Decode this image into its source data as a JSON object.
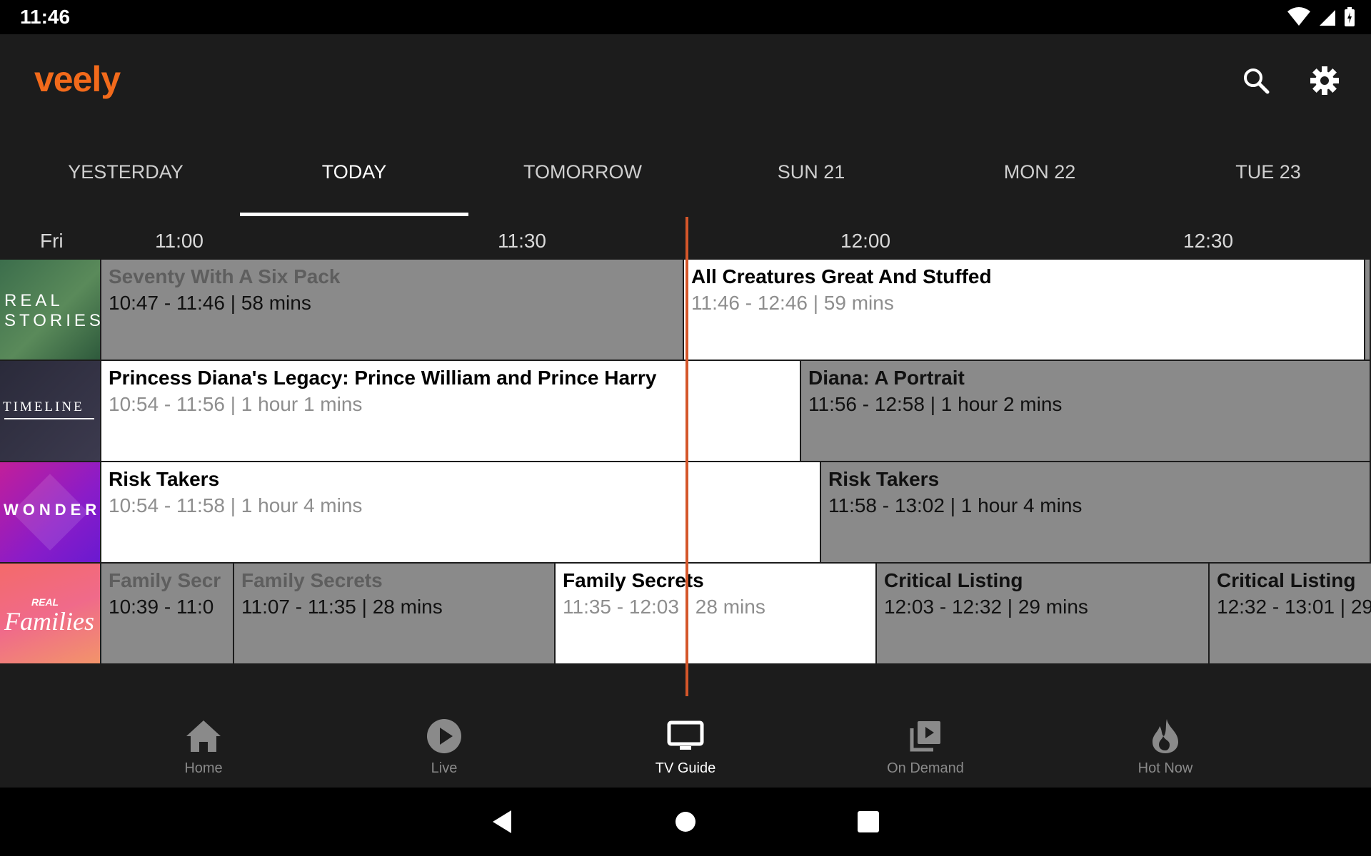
{
  "status_bar": {
    "time": "11:46"
  },
  "app": {
    "logo_text": "veely"
  },
  "date_tabs": [
    "YESTERDAY",
    "TODAY",
    "TOMORROW",
    "SUN 21",
    "MON 22",
    "TUE 23"
  ],
  "active_tab": "TODAY",
  "time_header": {
    "day": "Fri",
    "times": [
      "11:00",
      "11:30",
      "12:00",
      "12:30"
    ]
  },
  "channels": [
    {
      "name": "REAL STORIES",
      "logo_lines": [
        "REAL",
        "STORIES"
      ],
      "programs": [
        {
          "title": "Seventy With A Six Pack",
          "time": "10:47 - 11:46 | 58 mins",
          "state": "past"
        },
        {
          "title": "All Creatures Great And Stuffed",
          "time": "11:46 - 12:46 | 59 mins",
          "state": "live"
        }
      ]
    },
    {
      "name": "TIMELINE",
      "logo_lines": [
        "TIMELINE"
      ],
      "programs": [
        {
          "title": "Princess Diana's Legacy: Prince William and Prince Harry",
          "time": "10:54 - 11:56 | 1 hour 1 mins",
          "state": "live"
        },
        {
          "title": "Diana: A Portrait",
          "time": "11:56 - 12:58 | 1 hour 2 mins",
          "state": "future"
        }
      ]
    },
    {
      "name": "WONDER",
      "logo_lines": [
        "WONDER"
      ],
      "programs": [
        {
          "title": "Risk Takers",
          "time": "10:54 - 11:58 | 1 hour 4 mins",
          "state": "live"
        },
        {
          "title": "Risk Takers",
          "time": "11:58 - 13:02 | 1 hour 4 mins",
          "state": "future"
        }
      ]
    },
    {
      "name": "REAL Families",
      "logo_lines": [
        "REAL",
        "Families"
      ],
      "programs": [
        {
          "title": "Family Secr",
          "time": "10:39 - 11:0",
          "state": "past"
        },
        {
          "title": "Family Secrets",
          "time": "11:07 - 11:35 | 28 mins",
          "state": "past"
        },
        {
          "title": "Family Secrets",
          "time": "11:35 - 12:03 | 28 mins",
          "state": "live"
        },
        {
          "title": "Critical Listing",
          "time": "12:03 - 12:32 | 29 mins",
          "state": "future"
        },
        {
          "title": "Critical Listing",
          "time": "12:32 - 13:01 | 29",
          "state": "future"
        }
      ]
    }
  ],
  "bottom_nav": [
    {
      "label": "Home",
      "icon": "home-icon"
    },
    {
      "label": "Live",
      "icon": "play-circle-icon"
    },
    {
      "label": "TV Guide",
      "icon": "tv-icon"
    },
    {
      "label": "On Demand",
      "icon": "video-library-icon"
    },
    {
      "label": "Hot Now",
      "icon": "flame-icon"
    }
  ],
  "active_nav": "TV Guide",
  "colors": {
    "accent": "#f26a1b",
    "now_line": "#d4562a",
    "background": "#1c1c1c"
  }
}
